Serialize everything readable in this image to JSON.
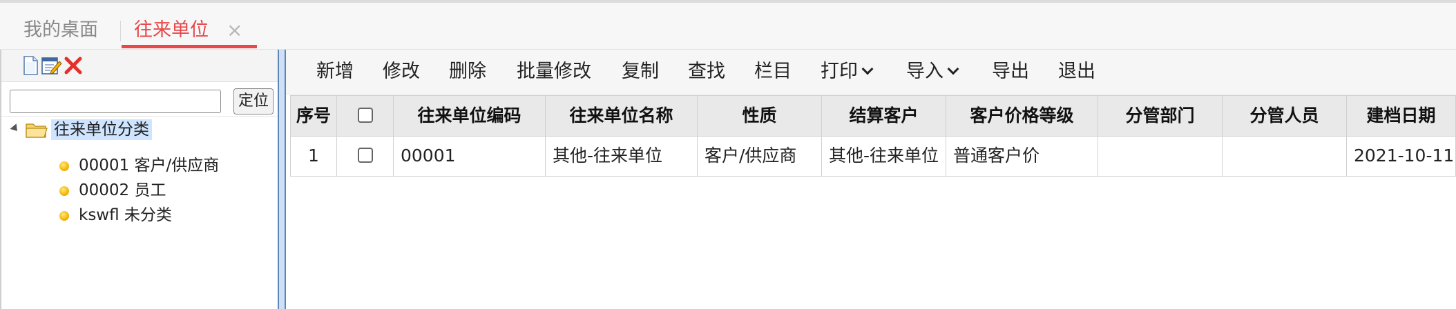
{
  "tabs": {
    "desktop": "我的桌面",
    "active": "往来单位",
    "close": "×"
  },
  "left_panel": {
    "toolbar": {
      "icons": [
        "new-document-icon",
        "edit-document-icon",
        "delete-x-icon"
      ]
    },
    "search": {
      "value": "",
      "placeholder": "",
      "locate_label": "定位"
    },
    "tree": {
      "root_label": "往来单位分类",
      "items": [
        {
          "label": "00001 客户/供应商"
        },
        {
          "label": "00002 员工"
        },
        {
          "label": "kswfl 未分类"
        }
      ]
    }
  },
  "toolbar": {
    "add": "新增",
    "modify": "修改",
    "delete": "删除",
    "batch_modify": "批量修改",
    "copy": "复制",
    "find": "查找",
    "columns": "栏目",
    "print": "打印",
    "import": "导入",
    "export": "导出",
    "exit": "退出"
  },
  "table": {
    "headers": {
      "seq": "序号",
      "code": "往来单位编码",
      "name": "往来单位名称",
      "nature": "性质",
      "settle": "结算客户",
      "price_level": "客户价格等级",
      "dept": "分管部门",
      "staff": "分管人员",
      "date": "建档日期"
    },
    "rows": [
      {
        "seq": "1",
        "code": "00001",
        "name": "其他-往来单位",
        "nature": "客户/供应商",
        "settle": "其他-往来单位",
        "price_level": "普通客户价",
        "dept": "",
        "staff": "",
        "date": "2021-10-11"
      }
    ]
  },
  "colors": {
    "accent": "#e8484a",
    "splitter": "#5a86b8",
    "selection": "#cfe4ff"
  }
}
